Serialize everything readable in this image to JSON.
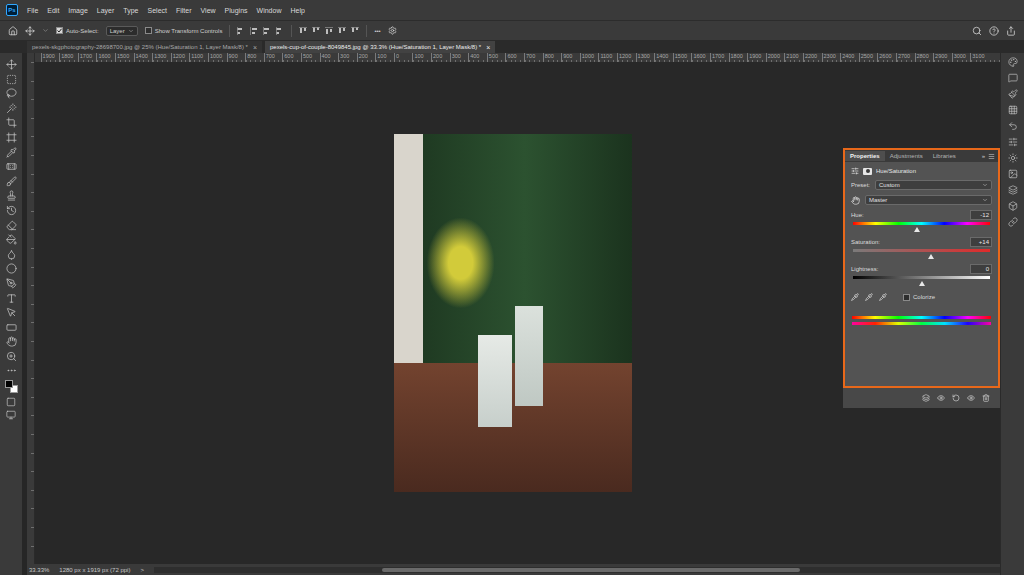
{
  "app": {
    "logo": "Ps"
  },
  "menu": [
    "File",
    "Edit",
    "Image",
    "Layer",
    "Type",
    "Select",
    "Filter",
    "View",
    "Plugins",
    "Window",
    "Help"
  ],
  "options_bar": {
    "auto_select": {
      "label": "Auto-Select:",
      "checked": true
    },
    "layer_dropdown": "Layer",
    "show_transform": {
      "label": "Show Transform Controls",
      "checked": false
    },
    "more": "•••"
  },
  "tabs": [
    {
      "label": "pexels-skgphotography-28698700.jpg @ 25% (Hue/Saturation 1, Layer Mask/8) *",
      "selected": false,
      "close": "×"
    },
    {
      "label": "pexels-cup-of-couple-8049845.jpg @ 33.3% (Hue/Saturation 1, Layer Mask/8) *",
      "selected": true,
      "close": "×"
    }
  ],
  "ruler": {
    "labels": [
      "1900",
      "1800",
      "1700",
      "1600",
      "1500",
      "1400",
      "1300",
      "1200",
      "1100",
      "1000",
      "900",
      "800",
      "700",
      "600",
      "500",
      "400",
      "300",
      "200",
      "100",
      "0",
      "100",
      "200",
      "300",
      "400",
      "500",
      "600",
      "700",
      "800",
      "900",
      "1000",
      "1100",
      "1200",
      "1300",
      "1400",
      "1500",
      "1600",
      "1700",
      "1800",
      "1900",
      "2000",
      "2100",
      "2200",
      "2300",
      "2400",
      "2500",
      "2600",
      "2700",
      "2800",
      "2900",
      "3000",
      "3100"
    ]
  },
  "properties": {
    "tabs": [
      {
        "label": "Properties",
        "selected": true
      },
      {
        "label": "Adjustments",
        "selected": false
      },
      {
        "label": "Libraries",
        "selected": false
      }
    ],
    "collapse": "»",
    "title": "Hue/Saturation",
    "preset_label": "Preset:",
    "preset": "Custom",
    "channel": "Master",
    "sliders": [
      {
        "label": "Hue:",
        "value": "-12",
        "level": 0.467,
        "kind": "hue"
      },
      {
        "label": "Saturation:",
        "value": "+14",
        "level": 0.57,
        "kind": "saturation"
      },
      {
        "label": "Lightness:",
        "value": "0",
        "level": 0.5,
        "kind": "lightness"
      }
    ],
    "colorize": {
      "label": "Colorize",
      "checked": false
    }
  },
  "status_bar": {
    "zoom": "33.33%",
    "info": "1280 px x 1919 px (72 ppi)",
    "arrow": ">"
  }
}
